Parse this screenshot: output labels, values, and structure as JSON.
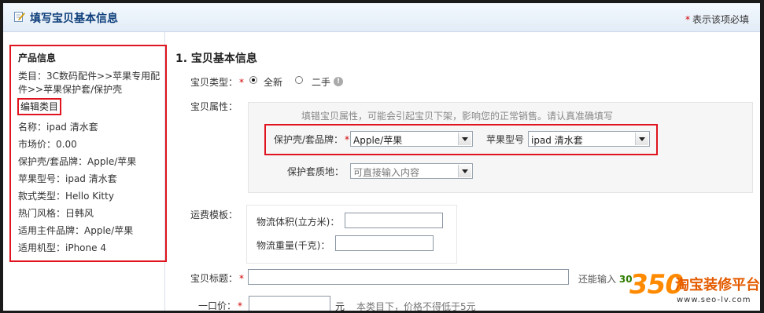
{
  "header": {
    "title": "填写宝贝基本信息",
    "required_note_star": "*",
    "required_note": "表示该项必填"
  },
  "sidebar": {
    "heading": "产品信息",
    "category": "类目：3C数码配件>>苹果专用配件>>苹果保护套/保护壳",
    "edit_category": "编辑类目",
    "attributes": [
      "名称：ipad 清水套",
      "市场价：0.00",
      "保护壳/套品牌：Apple/苹果",
      "苹果型号：ipad 清水套",
      "款式类型：Hello Kitty",
      "热门风格：日韩风",
      "适用主件品牌：Apple/苹果",
      "适用机型：iPhone 4"
    ]
  },
  "main": {
    "section_title": "1. 宝贝基本信息",
    "item_type": {
      "label": "宝贝类型：",
      "star": "*",
      "options": [
        "全新",
        "二手"
      ],
      "selected": "全新"
    },
    "item_attrs": {
      "label": "宝贝属性：",
      "hint": "填错宝贝属性，可能会引起宝贝下架，影响您的正常销售。请认真准确填写",
      "brand_label": "保护壳/套品牌：",
      "brand_star": "*",
      "brand_value": "Apple/苹果",
      "model_label": "苹果型号",
      "model_value": "ipad 清水套",
      "material_label": "保护套质地：",
      "material_placeholder": "可直接输入内容"
    },
    "shipping": {
      "label": "运费模板：",
      "volume_label": "物流体积(立方米)：",
      "weight_label": "物流重量(千克)：",
      "volume_value": "",
      "weight_value": ""
    },
    "title_field": {
      "label": "宝贝标题：",
      "star": "*",
      "value": "",
      "counter_prefix": "还能输入",
      "counter_value": "30"
    },
    "price_field": {
      "label": "一口价：",
      "star": "*",
      "value": "",
      "unit": "元",
      "note": "本类目下，价格不得低于5元"
    }
  },
  "watermark": {
    "logo": "350",
    "brand": "淘宝装修平台",
    "url": "www.seo-lv.com"
  },
  "colors": {
    "title_text": "#0e3f7a",
    "required_star": "#d20000",
    "annotation_box": "#e0141e",
    "counter_number": "#2e7d00",
    "watermark_orange": "#ff8a00"
  }
}
